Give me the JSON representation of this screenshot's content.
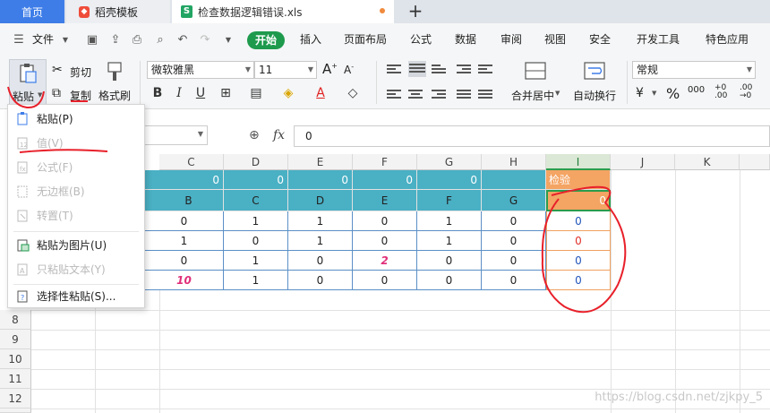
{
  "titlebar": {
    "home_tab": "首页",
    "daoke_tab": "稻壳模板",
    "file_tab": "检查数据逻辑错误.xls",
    "add_tab": "+"
  },
  "menubar": {
    "file_menu": "文件",
    "tabs": [
      "开始",
      "插入",
      "页面布局",
      "公式",
      "数据",
      "审阅",
      "视图",
      "安全",
      "开发工具",
      "特色应用"
    ]
  },
  "ribbon": {
    "paste": "粘贴",
    "cut": "剪切",
    "copy": "复制",
    "format_painter": "格式刷",
    "font_name": "微软雅黑",
    "font_size": "11",
    "merge_center": "合并居中",
    "wrap_text": "自动换行",
    "number_format": "常规",
    "percent": "%"
  },
  "formula_bar": {
    "fx": "fx",
    "value": "0"
  },
  "paste_menu": {
    "items": [
      {
        "label": "粘贴(P)",
        "enabled": true
      },
      {
        "label": "值(V)",
        "enabled": false
      },
      {
        "label": "公式(F)",
        "enabled": false
      },
      {
        "label": "无边框(B)",
        "enabled": false
      },
      {
        "label": "转置(T)",
        "enabled": false
      },
      {
        "label": "粘贴为图片(U)",
        "enabled": true
      },
      {
        "label": "只粘贴文本(Y)",
        "enabled": false
      },
      {
        "label": "选择性粘贴(S)...",
        "enabled": true
      }
    ]
  },
  "grid": {
    "columns": [
      "C",
      "D",
      "E",
      "F",
      "G",
      "H",
      "I",
      "J",
      "K"
    ],
    "rows": [
      "8",
      "9",
      "10",
      "11",
      "12"
    ],
    "row1": [
      "0",
      "0",
      "0",
      "0",
      "0",
      "检验"
    ],
    "row2": [
      "B",
      "C",
      "D",
      "E",
      "F",
      "G",
      "0"
    ],
    "data": [
      [
        "0",
        "1",
        "1",
        "0",
        "1",
        "0",
        "0"
      ],
      [
        "1",
        "0",
        "1",
        "0",
        "1",
        "0",
        "0"
      ],
      [
        "0",
        "1",
        "0",
        "2",
        "0",
        "0",
        "0"
      ],
      [
        "10",
        "1",
        "0",
        "0",
        "0",
        "0",
        "0"
      ]
    ]
  },
  "watermark": "https://blog.csdn.net/zjkpy_5",
  "colors": {
    "accent_blue": "#3e7de8",
    "start_green": "#1e9a4d",
    "header_teal": "#4ab0c4",
    "check_orange": "#f4a463",
    "annotation_red": "#e8202a",
    "highlight_pink": "#e0307a"
  }
}
